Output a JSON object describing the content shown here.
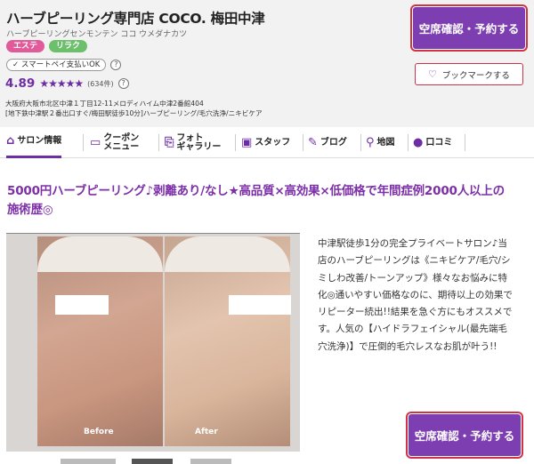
{
  "salon": {
    "name": "ハーブピーリング専門店 COCO. 梅田中津",
    "name_kana": "ハーブピーリングセンモンテン ココ ウメダナカツ",
    "tags": [
      "エステ",
      "リラク"
    ],
    "payment_badge": "スマートペイ支払いOK",
    "rating": "4.89",
    "stars": "★★★★★",
    "review_count": "(634件)",
    "address": "大阪府大阪市北区中津１丁目12-11メロディハイム中津2番館404",
    "access": "[地下鉄中津駅２番出口すぐ/梅田駅徒歩10分]ハーブピーリング/毛穴洗浄/ニキビケア"
  },
  "actions": {
    "book_label": "空席確認・予約する",
    "bookmark_label": "ブックマークする"
  },
  "nav": [
    {
      "label": "サロン情報",
      "icon": "house-icon"
    },
    {
      "label": "クーポン\nメニュー",
      "icon": "coupon-icon"
    },
    {
      "label": "フォト\nギャラリー",
      "icon": "camera-icon"
    },
    {
      "label": "スタッフ",
      "icon": "staff-icon"
    },
    {
      "label": "ブログ",
      "icon": "pen-icon"
    },
    {
      "label": "地図",
      "icon": "map-pin-icon"
    },
    {
      "label": "口コミ",
      "icon": "speech-bubble-icon"
    }
  ],
  "headline": "5000円ハーブピーリング♪剥離あり/なし★高品質×高効果×低価格で年間症例2000人以上の施術歴◎",
  "photo": {
    "before_label": "Before",
    "after_label": "After"
  },
  "description": "中津駅徒歩1分の完全プライベートサロン♪当店のハーブピーリングは《ニキビケア/毛穴/シミしわ改善/トーンアップ》様々なお悩みに特化◎通いやすい価格なのに、期待以上の効果でリピーター続出!!結果を急ぐ方にもオススメです。人気の【ハイドラフェイシャル(最先端毛穴洗浄)】で圧倒的毛穴レスなお肌が叶う!!"
}
